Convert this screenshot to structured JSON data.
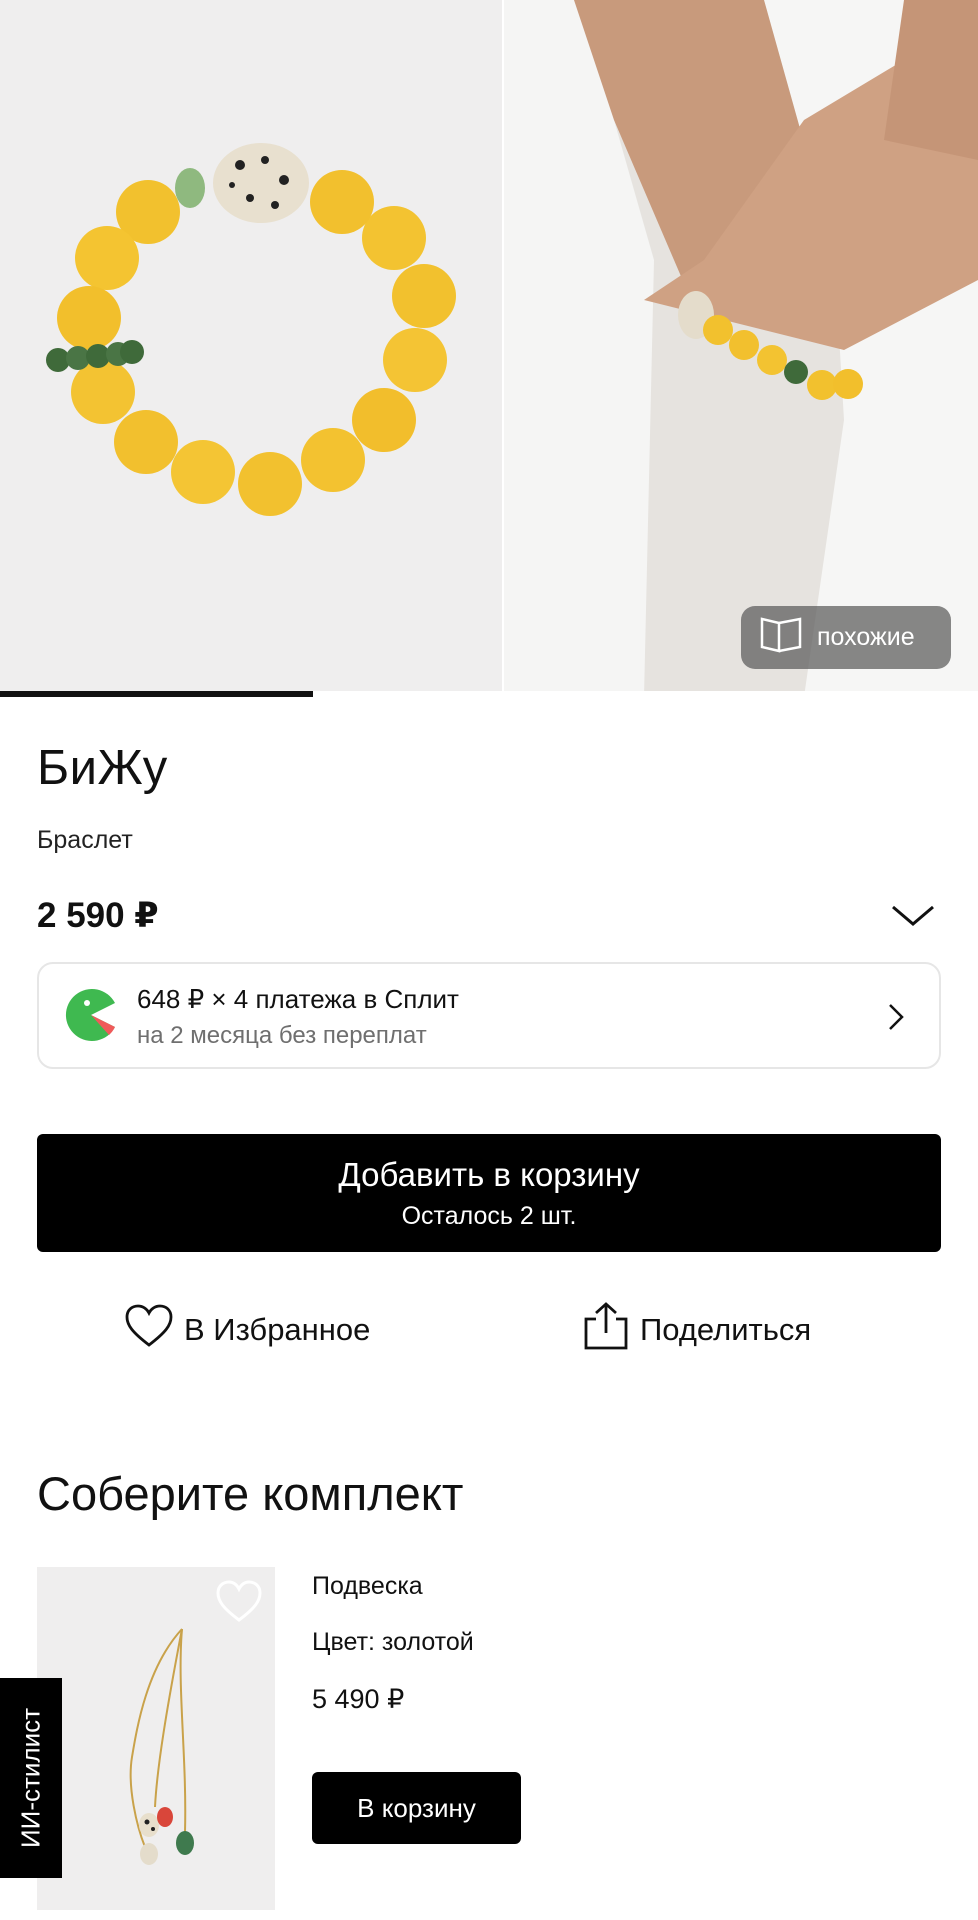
{
  "gallery": {
    "similar_label": "похожие",
    "progress": 0.32
  },
  "product": {
    "brand": "БиЖу",
    "type": "Браслет",
    "price": "2 590 ₽"
  },
  "split": {
    "line1": "648 ₽ × 4 платежа в Сплит",
    "line2": "на 2 месяца без переплат"
  },
  "cart_button": {
    "label": "Добавить в корзину",
    "stock": "Осталось 2 шт."
  },
  "actions": {
    "favorite": "В Избранное",
    "share": "Поделиться"
  },
  "set_section": {
    "title": "Соберите комплект",
    "item": {
      "name": "Подвеска",
      "color": "Цвет: золотой",
      "price": "5 490 ₽",
      "cart_label": "В корзину"
    }
  },
  "ai_stylist": {
    "label": "ИИ-стилист"
  },
  "colors": {
    "accent": "#000000",
    "split_green": "#3fb950",
    "split_red": "#f05a5a"
  },
  "icons": [
    "similar-cards-icon",
    "chevron-down-icon",
    "split-logo-icon",
    "chevron-right-icon",
    "heart-icon",
    "share-icon",
    "heart-outline-icon"
  ]
}
